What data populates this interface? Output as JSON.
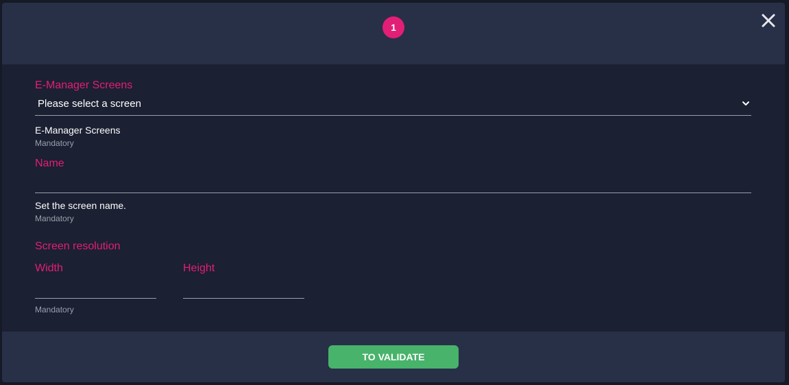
{
  "header": {
    "step_number": "1"
  },
  "form": {
    "screens_field": {
      "label": "E-Manager Screens",
      "selected_value": "Please select a screen",
      "help_text": "E-Manager Screens",
      "mandatory_text": "Mandatory"
    },
    "name_field": {
      "label": "Name",
      "value": "",
      "help_text": "Set the screen name.",
      "mandatory_text": "Mandatory"
    },
    "resolution": {
      "section_label": "Screen resolution",
      "width_label": "Width",
      "width_value": "",
      "height_label": "Height",
      "height_value": "",
      "mandatory_text": "Mandatory"
    }
  },
  "footer": {
    "validate_label": "TO VALIDATE"
  },
  "colors": {
    "accent_pink": "#e31e76",
    "button_green": "#48b36a",
    "panel_bg": "#283048",
    "body_bg": "#1b2032"
  },
  "icons": {
    "close": "close-icon",
    "dropdown": "chevron-down-icon"
  }
}
